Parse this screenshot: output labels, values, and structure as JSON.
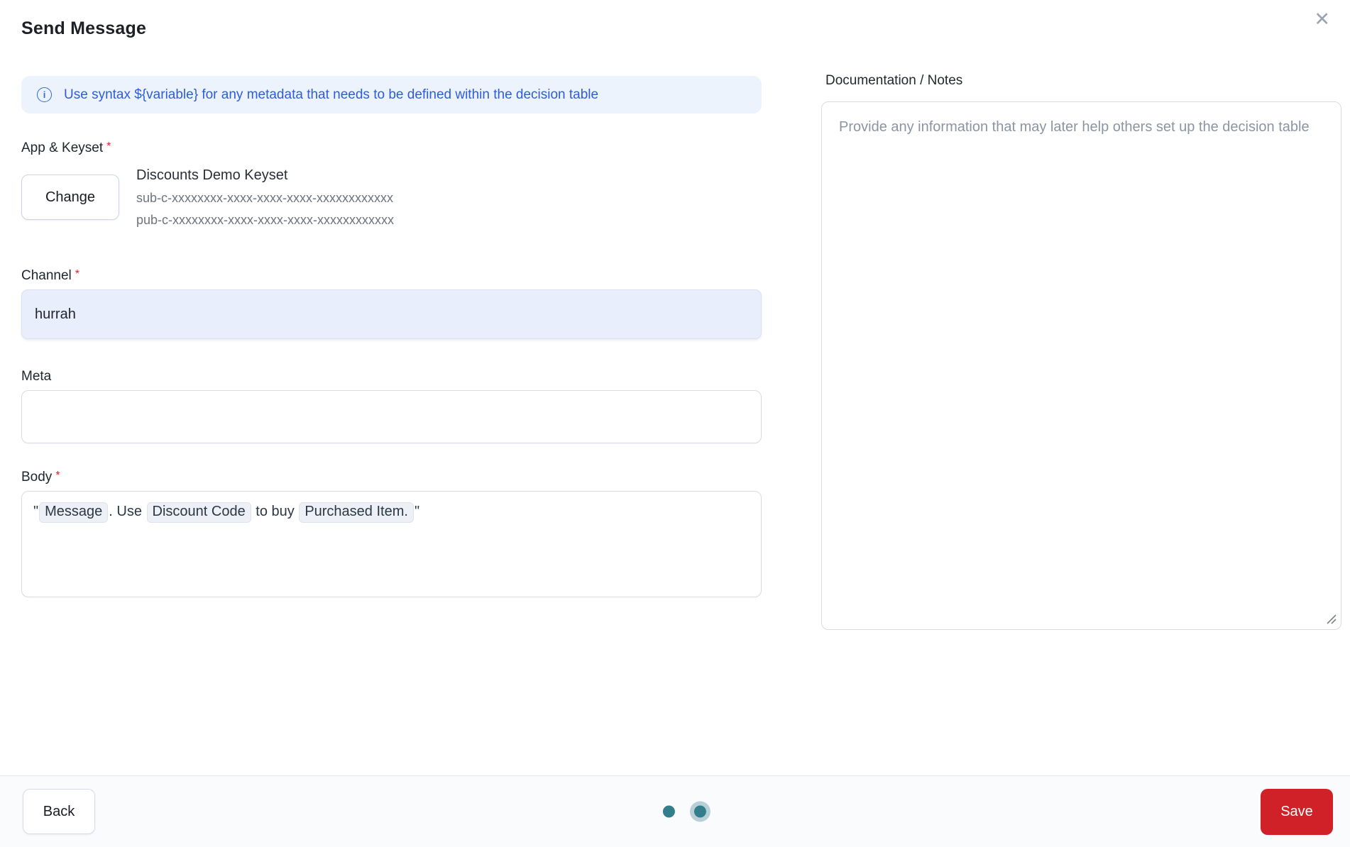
{
  "dialog": {
    "title": "Send Message"
  },
  "icons": {
    "close": "✕",
    "info": "i"
  },
  "banner": {
    "text": "Use syntax ${variable} for any metadata that needs to be defined within the decision table"
  },
  "fields": {
    "app_keyset": {
      "label": "App & Keyset",
      "required_mark": "*",
      "change_button_label": "Change",
      "keyset_name": "Discounts Demo Keyset",
      "subscribe_key": "sub-c-xxxxxxxx-xxxx-xxxx-xxxx-xxxxxxxxxxxx",
      "publish_key": "pub-c-xxxxxxxx-xxxx-xxxx-xxxx-xxxxxxxxxxxx"
    },
    "channel": {
      "label": "Channel",
      "required_mark": "*",
      "value": "hurrah"
    },
    "meta": {
      "label": "Meta",
      "value": ""
    },
    "body": {
      "label": "Body",
      "required_mark": "*",
      "tokens": [
        {
          "type": "text",
          "text": "\""
        },
        {
          "type": "chip",
          "text": "Message"
        },
        {
          "type": "text",
          "text": ". Use "
        },
        {
          "type": "chip",
          "text": "Discount Code"
        },
        {
          "type": "text",
          "text": " to buy "
        },
        {
          "type": "chip",
          "text": "Purchased Item."
        },
        {
          "type": "text",
          "text": "\""
        }
      ]
    },
    "documentation": {
      "label": "Documentation / Notes",
      "placeholder": "Provide any information that may later help others set up the decision table"
    }
  },
  "footer": {
    "back_button_label": "Back",
    "save_button_label": "Save",
    "pagination": {
      "dot_count": 2,
      "active_index": 1
    }
  },
  "colors": {
    "banner_bg": "#edf3fd",
    "banner_text": "#2d5ce0",
    "channel_field_bg": "#e8eefb",
    "save_button_bg": "#cf2127",
    "pagination_dot": "#337e8c",
    "pagination_ring": "#b8d0d5",
    "required_mark": "#d9262c"
  }
}
